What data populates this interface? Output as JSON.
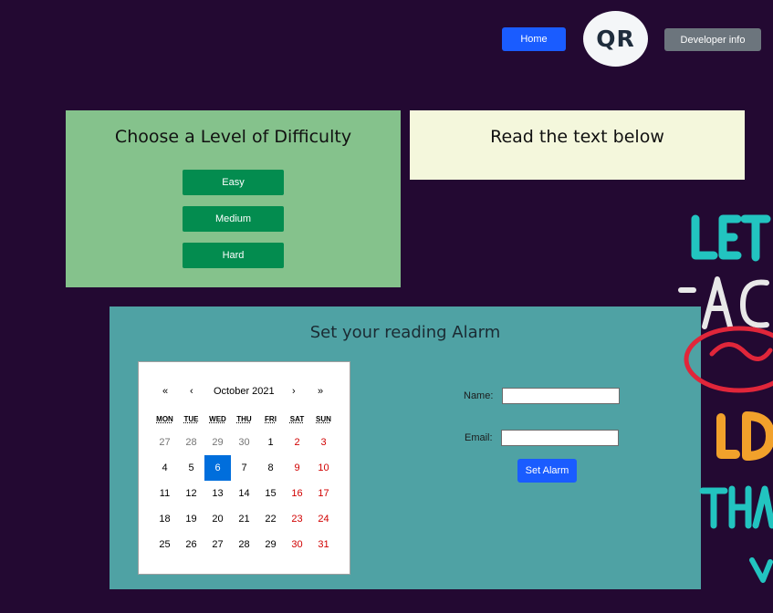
{
  "header": {
    "home_label": "Home",
    "logo_text": "QR",
    "developer_label": "Developer info"
  },
  "difficulty": {
    "title": "Choose a Level of Difficulty",
    "levels": [
      "Easy",
      "Medium",
      "Hard"
    ]
  },
  "reading": {
    "title": "Read the text below"
  },
  "alarm": {
    "title": "Set your reading Alarm",
    "calendar": {
      "nav_first": "«",
      "nav_prev": "‹",
      "month_label": "October 2021",
      "nav_next": "›",
      "nav_last": "»",
      "weekdays": [
        "MON",
        "TUE",
        "WED",
        "THU",
        "FRI",
        "SAT",
        "SUN"
      ],
      "weeks": [
        [
          "27",
          "28",
          "29",
          "30",
          "1",
          "2",
          "3"
        ],
        [
          "4",
          "5",
          "6",
          "7",
          "8",
          "9",
          "10"
        ],
        [
          "11",
          "12",
          "13",
          "14",
          "15",
          "16",
          "17"
        ],
        [
          "18",
          "19",
          "20",
          "21",
          "22",
          "23",
          "24"
        ],
        [
          "25",
          "26",
          "27",
          "28",
          "29",
          "30",
          "31"
        ]
      ],
      "selected_day": "6"
    },
    "form": {
      "name_label": "Name:",
      "name_value": "",
      "email_label": "Email:",
      "email_value": "",
      "submit_label": "Set Alarm"
    }
  },
  "colors": {
    "background": "#230932",
    "primary_button": "#1a5cff",
    "secondary_button": "#6c757d",
    "difficulty_panel": "#85c28c",
    "level_button": "#038c4f",
    "reading_panel": "#f4f7dc",
    "alarm_panel": "#4fa2a4",
    "calendar_selected": "#006edc",
    "weekend_text": "#d10000"
  }
}
